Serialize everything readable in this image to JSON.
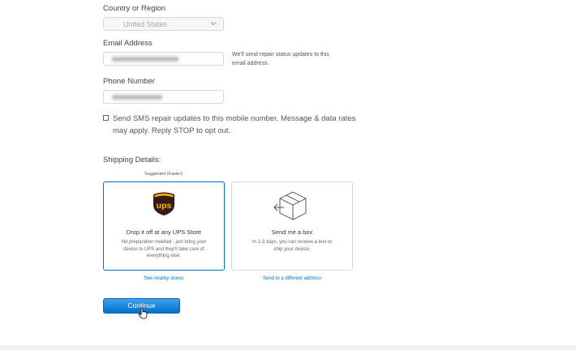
{
  "country": {
    "label": "Country or Region",
    "value": "United States"
  },
  "email": {
    "label": "Email Address",
    "note_line1": "We'll send repair status updates to this",
    "note_line2": "email address."
  },
  "phone": {
    "label": "Phone Number"
  },
  "sms": {
    "line1": "Send SMS repair updates to this mobile number. Message & data rates",
    "line2": "may apply. Reply STOP to opt out.",
    "checked": false
  },
  "shipping": {
    "heading": "Shipping Details:",
    "suggested": "Suggested (Faster)",
    "options": [
      {
        "title": "Drop it off at any UPS Store",
        "desc_line1": "No preparation needed - just bring your",
        "desc_line2": "device to UPS and they'll take care of",
        "desc_line3": "everything else.",
        "link": "See nearby stores",
        "logo_text": "ups",
        "selected": true
      },
      {
        "title": "Send me a box",
        "desc_line1": "In 1-3 days, you can receive a box to",
        "desc_line2": "ship your device.",
        "link": "Send to a different address",
        "selected": false
      }
    ]
  },
  "continue_label": "Continue",
  "colors": {
    "accent": "#0070c9",
    "selected_border": "#0070c9",
    "ups_brown": "#351c15",
    "ups_gold": "#ffb500"
  }
}
